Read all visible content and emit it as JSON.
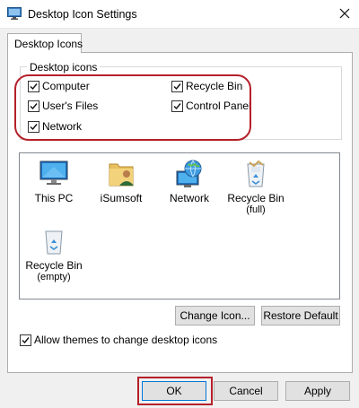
{
  "window": {
    "title": "Desktop Icon Settings",
    "close_icon": "close-icon"
  },
  "tab": {
    "label": "Desktop Icons"
  },
  "group": {
    "legend": "Desktop icons",
    "checkboxes": [
      {
        "label": "Computer",
        "checked": true
      },
      {
        "label": "Recycle Bin",
        "checked": true
      },
      {
        "label": "User's Files",
        "checked": true
      },
      {
        "label": "Control Panel",
        "checked": true
      },
      {
        "label": "Network",
        "checked": true
      }
    ]
  },
  "icons": [
    {
      "label": "This PC",
      "sub": "",
      "icon": "monitor-icon"
    },
    {
      "label": "iSumsoft",
      "sub": "",
      "icon": "user-folder-icon"
    },
    {
      "label": "Network",
      "sub": "",
      "icon": "network-globe-icon"
    },
    {
      "label": "Recycle Bin",
      "sub": "(full)",
      "icon": "recycle-bin-full-icon"
    },
    {
      "label": "Recycle Bin",
      "sub": "(empty)",
      "icon": "recycle-bin-empty-icon"
    }
  ],
  "buttons": {
    "change_icon": "Change Icon...",
    "restore_default": "Restore Default",
    "ok": "OK",
    "cancel": "Cancel",
    "apply": "Apply"
  },
  "allow_themes": {
    "label": "Allow themes to change desktop icons",
    "checked": true
  },
  "colors": {
    "highlight": "#b5202a",
    "accent": "#0078d7"
  }
}
